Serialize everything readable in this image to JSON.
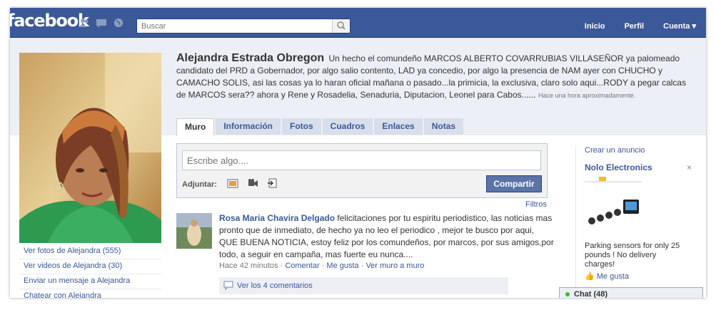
{
  "topbar": {
    "logo": "facebook",
    "search_placeholder": "Buscar",
    "nav": {
      "inicio": "Inicio",
      "perfil": "Perfil",
      "cuenta": "Cuenta ▾"
    },
    "icons": [
      "friends-icon",
      "messages-icon",
      "notifications-globe-icon",
      "search-icon"
    ]
  },
  "profile": {
    "name": "Alejandra Estrada Obregon",
    "status": "Un hecho el comundeño MARCOS ALBERTO COVARRUBIAS VILLASEÑOR ya palomeado candidato del PRD a Gobernador, por algo salio contento, LAD ya concedio, por algo la presencia de NAM ayer con CHUCHO y CAMACHO SOLIS, asi las cosas ya lo haran oficial mañana o pasado...la primicia, la exclusiva, claro solo aqui...RODY a pegar calcas de MARCOS sera?? ahora y Rene y Rosadelia, Senaduria, Diputacion, Leonel para Cabos......",
    "status_time": "Hace una hora aproximadamente."
  },
  "left_links": [
    "Ver fotos de Alejandra (555)",
    "Ver videos de Alejandra (30)",
    "Enviar un mensaje a Alejandra",
    "Chatear con Alejandra"
  ],
  "tabs": [
    "Muro",
    "Información",
    "Fotos",
    "Cuadros",
    "Enlaces",
    "Notas"
  ],
  "composer": {
    "placeholder": "Escribe algo....",
    "attach_label": "Adjuntar:",
    "share_label": "Compartir",
    "attach_icons": [
      "photo-icon",
      "video-icon",
      "link-icon"
    ]
  },
  "filters_label": "Filtros",
  "story": {
    "author": "Rosa Maria Chavira Delgado",
    "text": "felicitaciones por tu espiritu periodistico, las noticias mas pronto que de inmediato, de hecho ya no leo el periodico , mejor te busco por aqui, QUE BUENA NOTICIA, estoy feliz por los comundeños, por marcos, por sus amigos,por todo, a seguir en campaña, mas fuerte eu nunca....",
    "time": "Hace 42 minutos",
    "sep": " · ",
    "comment": "Comentar",
    "like": "Me gusta",
    "wall": "Ver muro a muro",
    "view_comments": "Ver los 4 comentarios"
  },
  "ads": {
    "create": "Crear un anuncio",
    "title": "Nolo Electronics",
    "close": "×",
    "text": "Parking sensors for only 25 pounds ! No delivery charges!",
    "like": "Me gusta"
  },
  "chat": {
    "label": "Chat (48)",
    "status_color": "#42b72a"
  },
  "colors": {
    "brand": "#3b5998",
    "link": "#3b5998",
    "header_bg": "#eceff5"
  }
}
